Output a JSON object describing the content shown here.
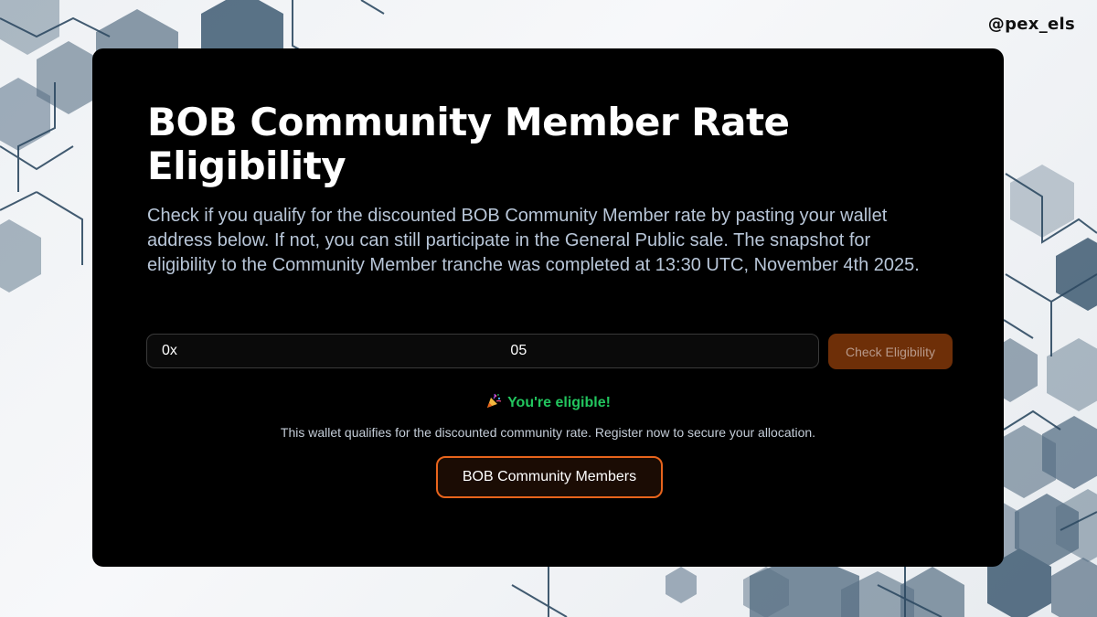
{
  "watermark": "@pex_els",
  "card": {
    "title": "BOB Community Member Rate Eligibility",
    "description": "Check if you qualify for the discounted BOB Community Member rate by pasting your wallet address below. If not, you can still participate in the General Public sale. The snapshot for eligibility to the Community Member tranche was completed at 13:30 UTC, November 4th 2025.",
    "wallet_input": {
      "value": "0x                                                                                  05"
    },
    "check_button_label": "Check Eligibility",
    "result": {
      "icon": "party-popper-icon",
      "status_text": "You're eligible!",
      "message": "This wallet qualifies for the discounted community rate. Register now to secure your allocation."
    },
    "cta_button_label": "BOB Community Members"
  },
  "colors": {
    "card_bg": "#000000",
    "success": "#22c55e",
    "accent": "#e8641c",
    "check_button_bg": "#6e2f08",
    "description_text": "#b8c6d8"
  }
}
